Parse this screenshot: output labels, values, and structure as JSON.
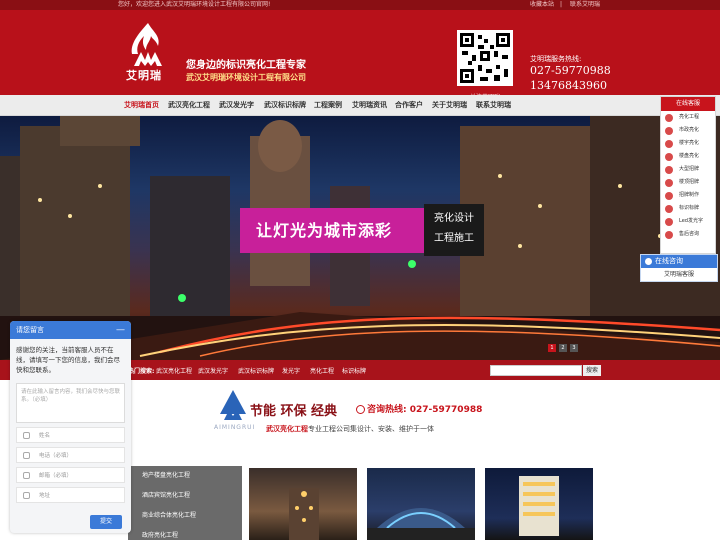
{
  "topbar": {
    "welcome": "您好，欢迎您进入武汉艾明瑞环境设计工程有限公司官网!",
    "links": [
      "收藏本站",
      "联系艾明瑞"
    ]
  },
  "header": {
    "brand": "艾明瑞",
    "slogan": "您身边的标识亮化工程专家",
    "company": "武汉艾明瑞环境设计工程有限公司",
    "qr_label": "关注艾明瑞",
    "hotline_label": "艾明瑞服务热线:",
    "phones": [
      "027-59770988",
      "13476843960"
    ]
  },
  "nav": [
    "艾明瑞首页",
    "武汉亮化工程",
    "武汉发光字",
    "武汉标识标牌",
    "工程案例",
    "艾明瑞资讯",
    "合作客户",
    "关于艾明瑞",
    "联系艾明瑞"
  ],
  "banner": {
    "sign_text": "让灯光为城市添彩",
    "side_lines": [
      "亮化设计",
      "工程施工"
    ],
    "dots": [
      "1",
      "2",
      "3"
    ]
  },
  "searchbar": {
    "label": "热门搜索:",
    "keywords": [
      "武汉亮化工程",
      "武汉发光字",
      "武汉标识标牌",
      "发光字",
      "亮化工程",
      "标识标牌"
    ],
    "button": "搜索"
  },
  "slogan": {
    "title": "节能 环保 经典",
    "hotline": "咨询热线: 027-59770988",
    "sub_red": "武汉亮化工程",
    "sub_rest": "专业工程公司集设计、安装、维护于一体",
    "en": "AIMINGRUI"
  },
  "categories": [
    "地产楼盘亮化工程",
    "酒店宾馆亮化工程",
    "商业综合体亮化工程",
    "政府亮化工程"
  ],
  "side_service": {
    "title": "在线客服",
    "items": [
      "亮化工程",
      "市政亮化",
      "楼宇亮化",
      "楼盘亮化",
      "大型招牌",
      "楼顶招牌",
      "招牌制作",
      "标识标牌",
      "Led发光字",
      "售后咨询"
    ]
  },
  "online": {
    "title": "在线咨询",
    "agent": "艾明瑞客服"
  },
  "message": {
    "title": "请您留言",
    "close": "—",
    "intro": "感谢您的关注，当前客服人员不在线，请填写一下您的信息，我们会尽快和您联系。",
    "textarea_placeholder": "请在此输入留言内容，我们会尽快与您联系。（必填）",
    "fields": [
      "姓名",
      "电话（必填）",
      "邮箱（必填）",
      "地址"
    ],
    "submit": "提交"
  },
  "colors": {
    "brand_red": "#b8111a",
    "dark_red": "#8a0f14",
    "accent_blue": "#3b7ad8"
  }
}
